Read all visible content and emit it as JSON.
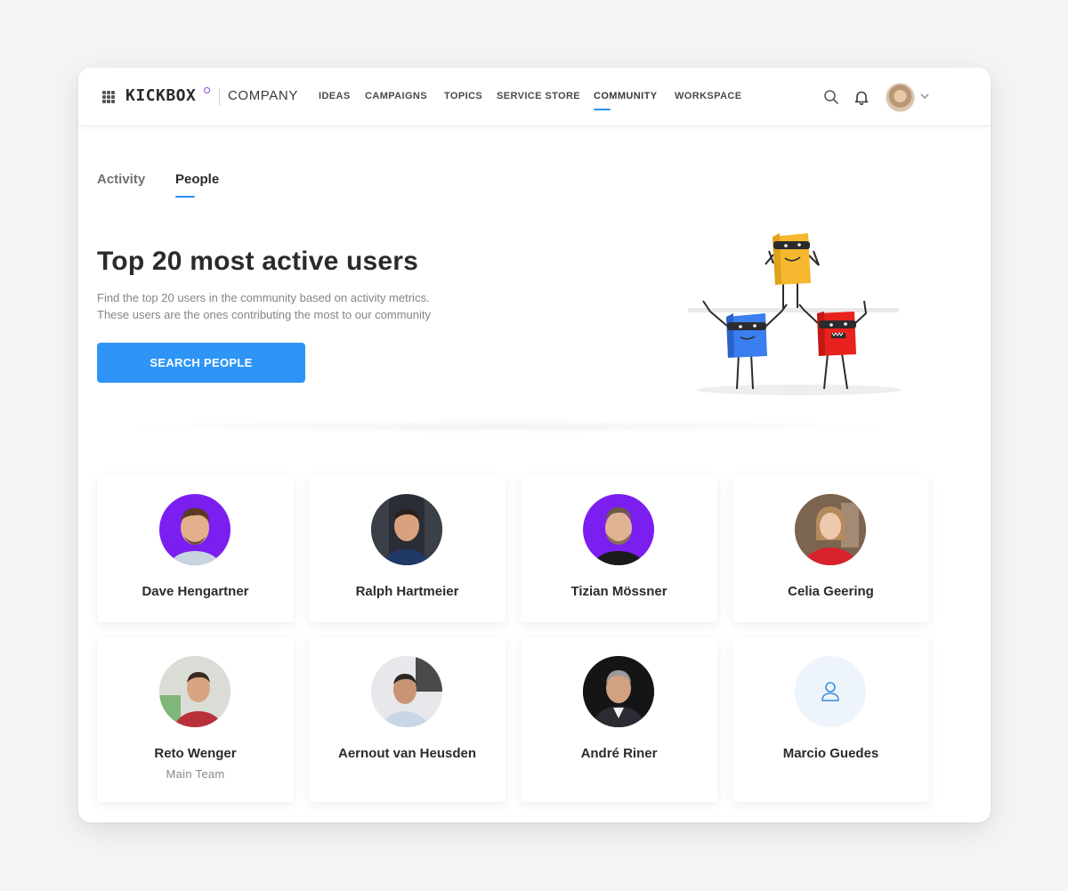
{
  "topbar": {
    "logo": "KICKBOX",
    "company": "COMPANY",
    "nav": [
      "IDEAS",
      "CAMPAIGNS",
      "TOPICS",
      "SERVICE STORE",
      "COMMUNITY",
      "WORKSPACE"
    ],
    "active_nav": "COMMUNITY",
    "icons": [
      "grid-icon",
      "search-icon",
      "bell-icon",
      "chevron-down-icon"
    ]
  },
  "tabs": [
    {
      "label": "Activity",
      "active": false
    },
    {
      "label": "People",
      "active": true
    }
  ],
  "hero": {
    "title": "Top 20 most active users",
    "description_line1": "Find the top 20 users in the community based on activity metrics.",
    "description_line2": "These users are the ones contributing the most to our community",
    "button_label": "SEARCH PEOPLE"
  },
  "people": [
    {
      "name": "Dave Hengartner",
      "subtitle": ""
    },
    {
      "name": "Ralph Hartmeier",
      "subtitle": ""
    },
    {
      "name": "Tizian Mössner",
      "subtitle": ""
    },
    {
      "name": "Celia Geering",
      "subtitle": ""
    },
    {
      "name": "Reto Wenger",
      "subtitle": "Main Team"
    },
    {
      "name": "Aernout van Heusden",
      "subtitle": ""
    },
    {
      "name": "André Riner",
      "subtitle": ""
    },
    {
      "name": "Marcio Guedes",
      "subtitle": ""
    }
  ],
  "colors": {
    "accent": "#2e95f6",
    "purple_avatar_bg": "#7a1ff0"
  }
}
